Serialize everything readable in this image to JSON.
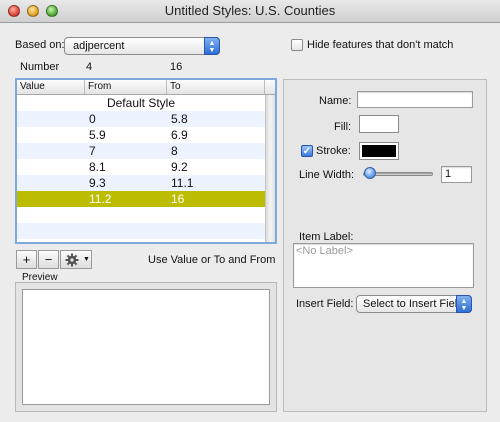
{
  "window": {
    "title": "Untitled Styles: U.S. Counties"
  },
  "based_on": {
    "label": "Based on:",
    "value": "adjpercent"
  },
  "hide_features": {
    "label": "Hide features that don't match",
    "checked": false
  },
  "number_row": {
    "label": "Number",
    "min": "4",
    "max": "16"
  },
  "table": {
    "columns": [
      "Value",
      "From",
      "To"
    ],
    "default_row": "Default Style",
    "rows": [
      {
        "from": "0",
        "to": "5.8"
      },
      {
        "from": "5.9",
        "to": "6.9"
      },
      {
        "from": "7",
        "to": "8"
      },
      {
        "from": "8.1",
        "to": "9.2"
      },
      {
        "from": "9.3",
        "to": "11.1"
      },
      {
        "from": "11.2",
        "to": "16"
      }
    ],
    "selected_index": 5,
    "selection_color": "#bcbc00"
  },
  "toolbar": {
    "add": "+",
    "remove": "−",
    "gear_icon": "gear-icon",
    "mode_text": "Use Value or To and From"
  },
  "preview": {
    "label": "Preview"
  },
  "panel": {
    "name_label": "Name:",
    "name_value": "",
    "fill_label": "Fill:",
    "fill_color": "#ffffff",
    "stroke_label": "Stroke:",
    "stroke_checked": true,
    "stroke_color": "#000000",
    "line_width_label": "Line Width:",
    "line_width_value": "1",
    "item_label_label": "Item Label:",
    "item_label_placeholder": "<No Label>",
    "insert_field_label": "Insert Field:",
    "insert_field_value": "Select to Insert Field"
  }
}
